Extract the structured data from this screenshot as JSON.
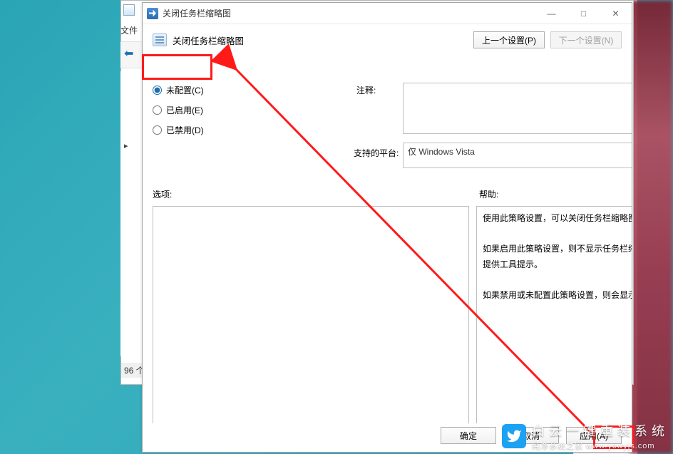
{
  "under": {
    "menu_file": "文件",
    "status": "96 个",
    "tree_item": "▸"
  },
  "dialog": {
    "title": "关闭任务栏缩略图",
    "header_title": "关闭任务栏缩略图",
    "nav_prev": "上一个设置(P)",
    "nav_next": "下一个设置(N)",
    "radios": {
      "not_configured": "未配置(C)",
      "enabled": "已启用(E)",
      "disabled": "已禁用(D)"
    },
    "comment_label": "注释:",
    "comment_value": "",
    "platform_label": "支持的平台:",
    "platform_value": "仅 Windows Vista",
    "options_label": "选项:",
    "help_label": "帮助:",
    "help_text": "使用此策略设置，可以关闭任务栏缩略图。\n\n如果启用此策略设置，则不显示任务栏缩略图，并且系统将使用标准文本提供工具提示。\n\n如果禁用或未配置此策略设置，则会显示任务栏缩略图。",
    "footer": {
      "ok": "确定",
      "cancel": "取消",
      "apply": "应用(A)"
    }
  },
  "window_controls": {
    "minimize": "—",
    "maximize": "□",
    "close": "✕"
  },
  "watermark": {
    "top": "白云一键重装系统",
    "sub": "纯净系统之家    www.ycwyjs.com"
  },
  "annotation": {
    "color": "#ff1a1a"
  }
}
